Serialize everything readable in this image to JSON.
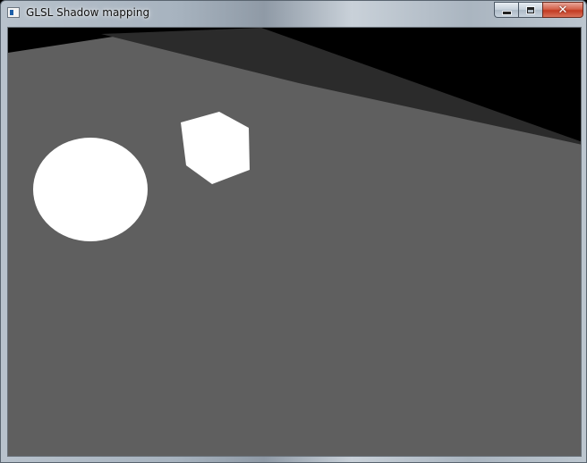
{
  "window": {
    "title": "GLSL Shadow mapping",
    "icon": "app-window-icon",
    "controls": {
      "minimize_icon": "minimize-icon",
      "maximize_icon": "maximize-icon",
      "close_glyph": "✕"
    }
  },
  "scene": {
    "floor_color": "#5f5f5f",
    "background_color": "#000000",
    "shadow_color": "#2a2a2a",
    "object_color": "#ffffff",
    "objects": [
      "sphere",
      "cube",
      "floor-plane",
      "shadow"
    ]
  }
}
